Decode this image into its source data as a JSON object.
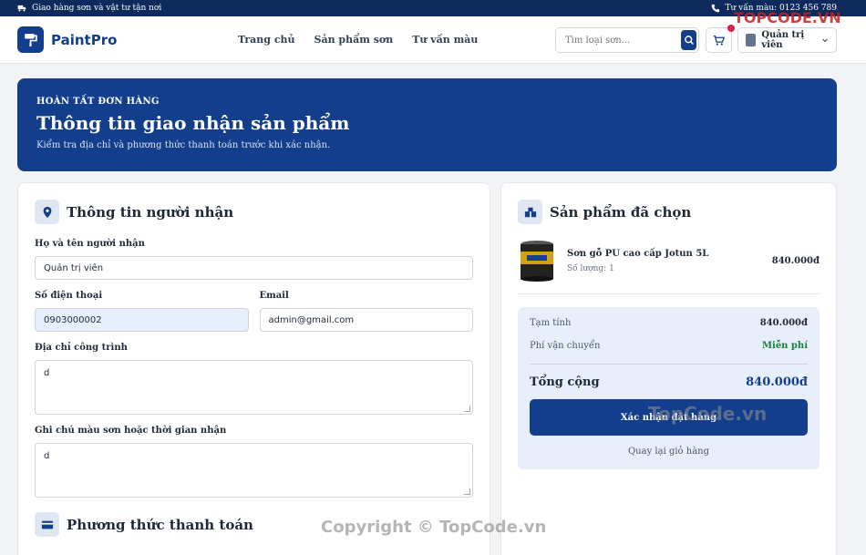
{
  "topbar": {
    "left_text": "Giao hàng sơn và vật tư tận nơi",
    "right_text": "Tư vấn màu: 0123 456 789"
  },
  "header": {
    "brand": "PaintPro",
    "nav": [
      "Trang chủ",
      "Sản phẩm sơn",
      "Tư vấn màu"
    ],
    "search_placeholder": "Tìm loại sơn...",
    "user_name": "Quản trị viên"
  },
  "hero": {
    "kicker": "HOÀN TẤT ĐƠN HÀNG",
    "title": "Thông tin giao nhận sản phẩm",
    "subtitle": "Kiểm tra địa chỉ và phương thức thanh toán trước khi xác nhận."
  },
  "recipient": {
    "title": "Thông tin người nhận",
    "name_label": "Họ và tên người nhận",
    "name_value": "Quản trị viên",
    "phone_label": "Số điện thoại",
    "phone_value": "0903000002",
    "email_label": "Email",
    "email_value": "admin@gmail.com",
    "address_label": "Địa chỉ công trình",
    "address_value": "d",
    "note_label": "Ghi chú màu sơn hoặc thời gian nhận",
    "note_value": "d"
  },
  "payment": {
    "title": "Phương thức thanh toán"
  },
  "order": {
    "title": "Sản phẩm đã chọn",
    "product_name": "Sơn gỗ PU cao cấp Jotun 5L",
    "product_qty": "Số lượng: 1",
    "product_price": "840.000đ",
    "subtotal_label": "Tạm tính",
    "subtotal_value": "840.000đ",
    "shipping_label": "Phí vận chuyển",
    "shipping_value": "Miễn phí",
    "total_label": "Tổng cộng",
    "total_value": "840.000đ",
    "confirm_label": "Xác nhận đặt hàng",
    "back_label": "Quay lại giỏ hàng"
  },
  "watermark": {
    "logo": "TOPCODE.VN",
    "mid": "TopCode.vn",
    "bottom": "Copyright © TopCode.vn"
  },
  "colors": {
    "brand": "#123e8c",
    "topbar": "#0e2a5c",
    "success": "#15803d"
  }
}
